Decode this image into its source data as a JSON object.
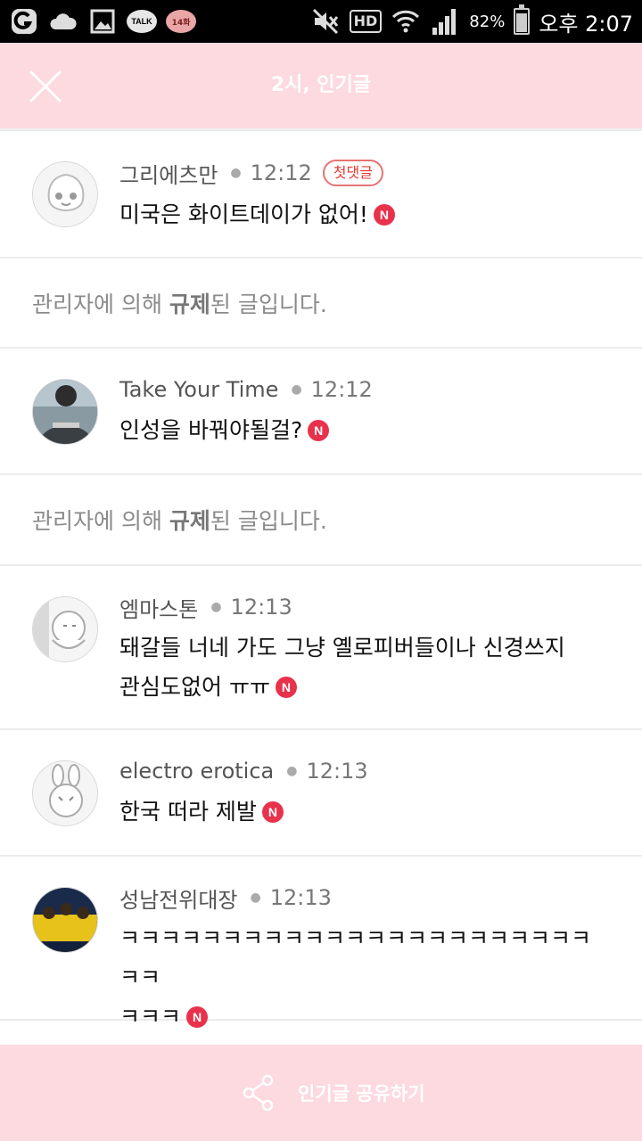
{
  "status_bar": {
    "talk_label": "TALK",
    "count_label": "14화",
    "hd_label": "HD",
    "battery_text": "82%",
    "time_text": "오후 2:07"
  },
  "header": {
    "title": "2시, 인기글"
  },
  "comments": [
    {
      "author": "그리에츠만",
      "time": "12:12",
      "badge": "첫댓글",
      "text": "미국은 화이트데이가 없어!",
      "new_badge": "N"
    },
    {
      "blocked_prefix": "관리자에 의해 ",
      "blocked_bold": "규제",
      "blocked_suffix": "된 글입니다."
    },
    {
      "author": "Take Your Time",
      "time": "12:12",
      "text": "인성을 바꿔야될걸?",
      "new_badge": "N"
    },
    {
      "blocked_prefix": "관리자에 의해 ",
      "blocked_bold": "규제",
      "blocked_suffix": "된 글입니다."
    },
    {
      "author": "엠마스톤",
      "time": "12:13",
      "text_line1": "돼갈들 너네 가도 그냥 옐로피버들이나 신경쓰지",
      "text_line2": "관심도없어 ㅠㅠ",
      "new_badge": "N"
    },
    {
      "author": "electro erotica",
      "time": "12:13",
      "text": "한국 떠라 제발",
      "new_badge": "N"
    },
    {
      "author": "성남전위대장",
      "time": "12:13",
      "text_line1": "ㅋㅋㅋㅋㅋㅋㅋㅋㅋㅋㅋㅋㅋㅋㅋㅋㅋㅋㅋㅋㅋㅋㅋㅋㅋ",
      "text_line2": "ㅋㅋㅋ",
      "new_badge": "N"
    }
  ],
  "footer": {
    "share_label": "인기글 공유하기"
  },
  "colors": {
    "header_bg": "#fdd9e0",
    "new_badge": "#e8324c",
    "first_badge": "#e53935"
  },
  "icons": {
    "close": "close-icon",
    "share": "share-icon"
  }
}
